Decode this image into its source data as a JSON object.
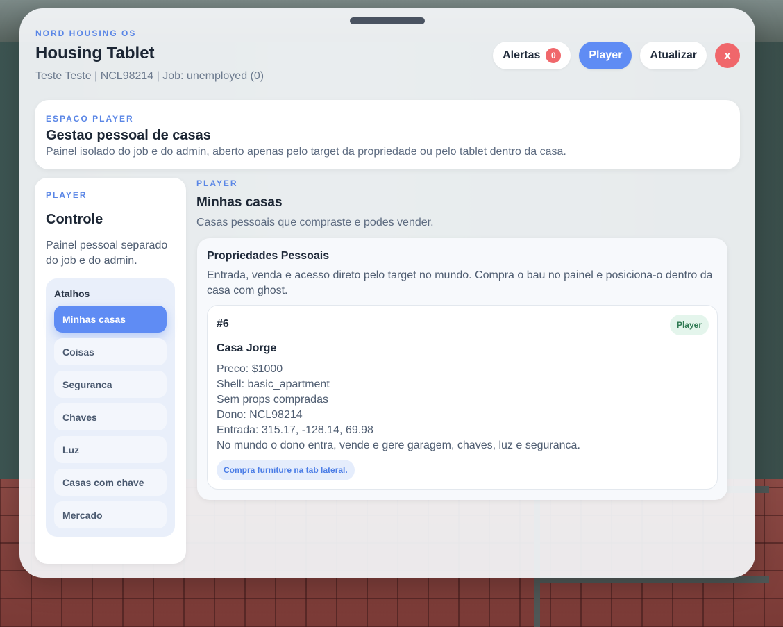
{
  "header": {
    "brand": "NORD HOUSING OS",
    "title": "Housing Tablet",
    "user_info": "Teste Teste | NCL98214 | Job: unemployed (0)",
    "alerts_label": "Alertas",
    "alerts_count": "0",
    "player_label": "Player",
    "refresh_label": "Atualizar",
    "close_label": "x"
  },
  "hero": {
    "eyebrow": "ESPACO PLAYER",
    "title": "Gestao pessoal de casas",
    "description": "Painel isolado do job e do admin, aberto apenas pelo target da propriedade ou pelo tablet dentro da casa."
  },
  "sidebar": {
    "eyebrow": "PLAYER",
    "title": "Controle",
    "description": "Painel pessoal separado do job e do admin.",
    "shortcuts_title": "Atalhos",
    "items": [
      {
        "label": "Minhas casas"
      },
      {
        "label": "Coisas"
      },
      {
        "label": "Seguranca"
      },
      {
        "label": "Chaves"
      },
      {
        "label": "Luz"
      },
      {
        "label": "Casas com chave"
      },
      {
        "label": "Mercado"
      }
    ]
  },
  "main": {
    "eyebrow": "PLAYER",
    "title": "Minhas casas",
    "description": "Casas pessoais que compraste e podes vender.",
    "panel": {
      "title": "Propriedades Pessoais",
      "description": "Entrada, venda e acesso direto pelo target no mundo. Compra o bau no painel e posiciona-o dentro da casa com ghost.",
      "card": {
        "id": "#6",
        "tag": "Player",
        "name": "Casa Jorge",
        "price": "Preco: $1000",
        "shell": "Shell: basic_apartment",
        "props": "Sem props compradas",
        "owner": "Dono: NCL98214",
        "entry": "Entrada: 315.17, -128.14, 69.98",
        "note": "No mundo o dono entra, vende e gere garagem, chaves, luz e seguranca.",
        "hint": "Compra furniture na tab lateral."
      }
    }
  },
  "colors": {
    "accent": "#5f8cf4",
    "danger": "#f0676b",
    "tag_bg": "#e4f5ec",
    "tag_text": "#2f7a53"
  },
  "icons": {
    "close": "close-icon"
  }
}
